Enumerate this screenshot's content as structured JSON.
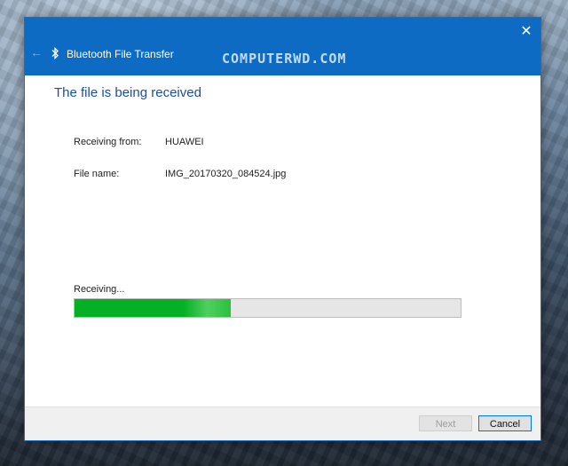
{
  "window": {
    "title": "Bluetooth File Transfer",
    "close_glyph": "✕",
    "back_glyph": "←",
    "watermark": "COMPUTERWD.COM"
  },
  "content": {
    "heading": "The file is being received",
    "receiving_from_label": "Receiving from:",
    "receiving_from_value": "HUAWEI",
    "file_name_label": "File name:",
    "file_name_value": "IMG_20170320_084524.jpg",
    "status_text": "Receiving...",
    "progress_fraction": 0.405
  },
  "buttons": {
    "next": "Next",
    "cancel": "Cancel"
  },
  "colors": {
    "titlebar": "#0e6bc4",
    "heading": "#1b4fa0",
    "progress": "#06b025",
    "focus_border": "#0078d7"
  },
  "icons": {
    "back": "back-arrow-icon",
    "bluetooth": "bluetooth-icon",
    "close": "close-icon"
  }
}
